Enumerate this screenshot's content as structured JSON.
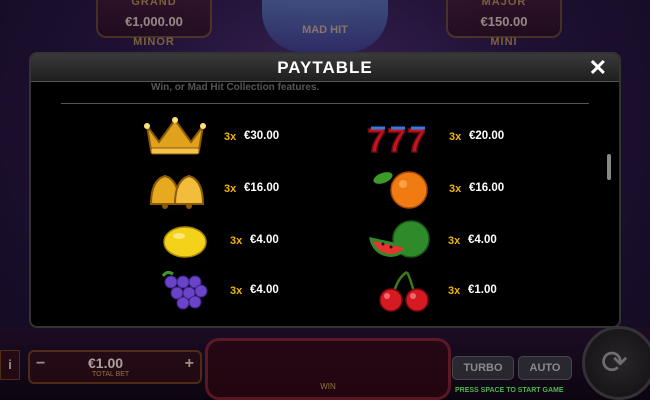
{
  "jackpots": {
    "grand": {
      "label": "GRAND",
      "value": "€1,000.00"
    },
    "major": {
      "label": "MAJOR",
      "value": "€150.00"
    },
    "minor_label": "MINOR",
    "mini_label": "MINI"
  },
  "logo_text": "MAD HIT",
  "modal": {
    "title": "PAYTABLE",
    "close_icon": "close-icon",
    "faded_text": "Win, or Mad Hit Collection features.",
    "rows": [
      {
        "symbol": "crown",
        "multiplier": "3x",
        "payout": "€30.00"
      },
      {
        "symbol": "sevens",
        "multiplier": "3x",
        "payout": "€20.00"
      },
      {
        "symbol": "bells",
        "multiplier": "3x",
        "payout": "€16.00"
      },
      {
        "symbol": "orange",
        "multiplier": "3x",
        "payout": "€16.00"
      },
      {
        "symbol": "lemon",
        "multiplier": "3x",
        "payout": "€4.00"
      },
      {
        "symbol": "watermelon",
        "multiplier": "3x",
        "payout": "€4.00"
      },
      {
        "symbol": "grapes",
        "multiplier": "3x",
        "payout": "€4.00"
      },
      {
        "symbol": "cherries",
        "multiplier": "3x",
        "payout": "€1.00"
      }
    ]
  },
  "bottom_bar": {
    "info": "i",
    "minus": "−",
    "plus": "+",
    "bet_value": "€1.00",
    "bet_label": "TOTAL BET",
    "win_label": "WIN",
    "turbo_label": "TURBO",
    "auto_label": "AUTO",
    "hint": "PRESS SPACE TO START GAME"
  },
  "colors": {
    "accent": "#f0b400",
    "modal_bg": "#000000",
    "header_bg": "#2a2a2a"
  }
}
